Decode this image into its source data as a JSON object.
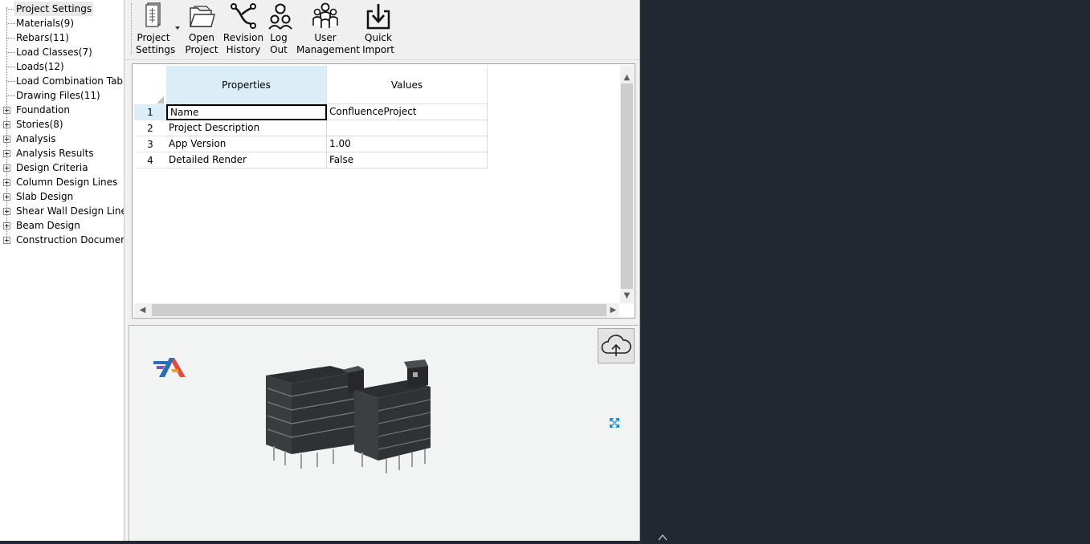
{
  "tree": {
    "items": [
      {
        "label": "Project Settings",
        "expandable": false,
        "selected": true
      },
      {
        "label": "Materials(9)",
        "expandable": false
      },
      {
        "label": "Rebars(11)",
        "expandable": false
      },
      {
        "label": "Load Classes(7)",
        "expandable": false
      },
      {
        "label": "Loads(12)",
        "expandable": false
      },
      {
        "label": "Load Combination Table(",
        "expandable": false
      },
      {
        "label": "Drawing Files(11)",
        "expandable": false
      },
      {
        "label": "Foundation",
        "expandable": true
      },
      {
        "label": "Stories(8)",
        "expandable": true
      },
      {
        "label": "Analysis",
        "expandable": true
      },
      {
        "label": "Analysis Results",
        "expandable": true
      },
      {
        "label": "Design Criteria",
        "expandable": true
      },
      {
        "label": "Column Design Lines",
        "expandable": true
      },
      {
        "label": "Slab Design",
        "expandable": true
      },
      {
        "label": "Shear Wall Design Lines",
        "expandable": true
      },
      {
        "label": "Beam Design",
        "expandable": true
      },
      {
        "label": "Construction Documents",
        "expandable": true
      }
    ]
  },
  "toolbar": {
    "project_settings": {
      "line1": "Project",
      "line2": "Settings"
    },
    "open_project": {
      "line1": "Open",
      "line2": "Project"
    },
    "revision_history": {
      "line1": "Revision",
      "line2": "History"
    },
    "log_out": {
      "line1": "Log",
      "line2": "Out"
    },
    "user_management": {
      "line1": "User",
      "line2": "Management"
    },
    "quick_import": {
      "line1": "Quick",
      "line2": "Import"
    }
  },
  "grid": {
    "columns": {
      "properties": "Properties",
      "values": "Values"
    },
    "rows": [
      {
        "num": "1",
        "property": "Name",
        "value": "ConfluenceProject"
      },
      {
        "num": "2",
        "property": "Project Description",
        "value": ""
      },
      {
        "num": "3",
        "property": "App Version",
        "value": "1.00"
      },
      {
        "num": "4",
        "property": "Detailed Render",
        "value": "False"
      }
    ]
  },
  "colors": {
    "header_highlight": "#dbeef7",
    "right_panel_bg": "#222831",
    "expand_icon": "#1a86d0"
  }
}
